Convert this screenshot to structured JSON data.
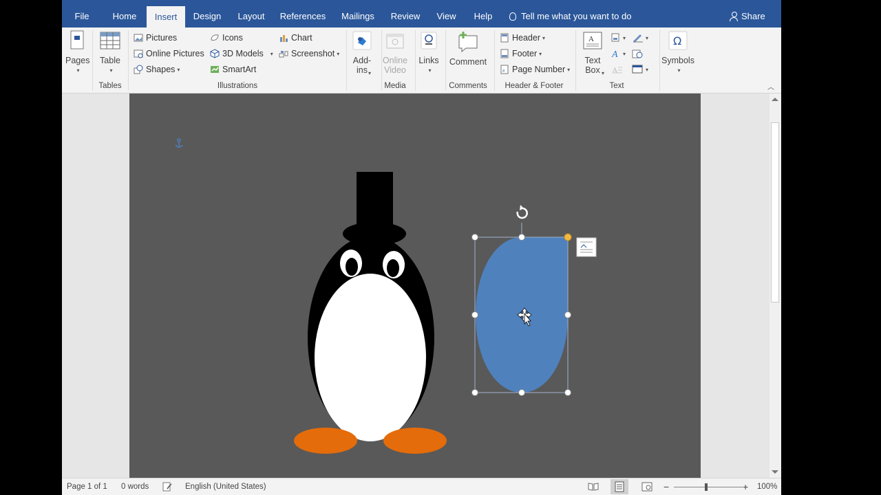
{
  "tabs": [
    "File",
    "Home",
    "Insert",
    "Design",
    "Layout",
    "References",
    "Mailings",
    "Review",
    "View",
    "Help"
  ],
  "active_tab": "Insert",
  "tell_me": "Tell me what you want to do",
  "share": "Share",
  "ribbon": {
    "pages": "Pages",
    "table": "Table",
    "tables_group": "Tables",
    "pictures": "Pictures",
    "online_pictures": "Online Pictures",
    "shapes": "Shapes",
    "icons": "Icons",
    "models_3d": "3D Models",
    "smartart": "SmartArt",
    "chart": "Chart",
    "screenshot": "Screenshot",
    "illustrations_group": "Illustrations",
    "addins_1": "Add-",
    "addins_2": "ins",
    "online_video_1": "Online",
    "online_video_2": "Video",
    "media_group": "Media",
    "links": "Links",
    "comment": "Comment",
    "comments_group": "Comments",
    "header": "Header",
    "footer": "Footer",
    "page_number": "Page Number",
    "header_footer_group": "Header & Footer",
    "text_box_1": "Text",
    "text_box_2": "Box",
    "text_group": "Text",
    "symbols": "Symbols"
  },
  "status": {
    "page": "Page 1 of 1",
    "words": "0 words",
    "language": "English (United States)",
    "zoom": "100%"
  },
  "colors": {
    "title_bar": "#2b579a",
    "page_bg": "#595959",
    "selected_shape": "#4f81bd",
    "penguin_feet": "#e46c0a"
  }
}
